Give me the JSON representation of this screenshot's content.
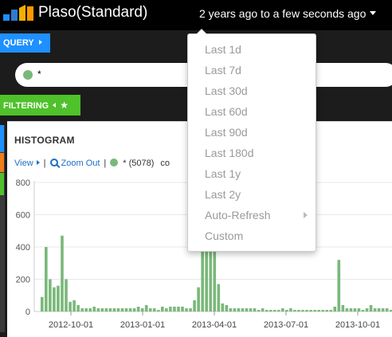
{
  "header": {
    "app_title": "Plaso(Standard)",
    "timepicker_label": "2 years ago to a few seconds ago"
  },
  "query": {
    "tab_label": "QUERY",
    "input_value": "*"
  },
  "filtering": {
    "tab_label": "FILTERING"
  },
  "colors": {
    "query_accent": "#1e90ff",
    "filtering_accent": "#4fc12a",
    "series": "#7ab87a"
  },
  "histogram": {
    "title": "HISTOGRAM",
    "view_label": "View",
    "zoom_out_label": "Zoom Out",
    "legend_label": "* (5078)",
    "legend_extra": "co"
  },
  "time_menu": {
    "items": [
      "Last 1d",
      "Last 7d",
      "Last 30d",
      "Last 60d",
      "Last 90d",
      "Last 180d",
      "Last 1y",
      "Last 2y",
      "Auto-Refresh",
      "Custom"
    ]
  },
  "chart_data": {
    "type": "bar",
    "ylim": [
      0,
      800
    ],
    "y_ticks": [
      0,
      200,
      400,
      600,
      800
    ],
    "x_tick_labels": [
      "2012-10-01",
      "2013-01-01",
      "2013-04-01",
      "2013-07-01",
      "2013-10-01"
    ],
    "grid": true,
    "values": [
      90,
      400,
      200,
      150,
      160,
      470,
      200,
      60,
      70,
      40,
      20,
      20,
      20,
      30,
      20,
      20,
      20,
      20,
      20,
      20,
      20,
      20,
      20,
      20,
      30,
      20,
      40,
      20,
      20,
      10,
      30,
      20,
      30,
      30,
      30,
      30,
      20,
      20,
      70,
      150,
      400,
      600,
      600,
      600,
      170,
      50,
      40,
      20,
      20,
      20,
      20,
      20,
      20,
      20,
      10,
      20,
      10,
      10,
      10,
      10,
      20,
      10,
      20,
      10,
      10,
      10,
      10,
      10,
      10,
      10,
      10,
      10,
      10,
      30,
      320,
      40,
      20,
      20,
      20,
      20,
      10,
      20,
      40,
      20,
      20,
      20,
      20,
      10,
      10
    ]
  }
}
